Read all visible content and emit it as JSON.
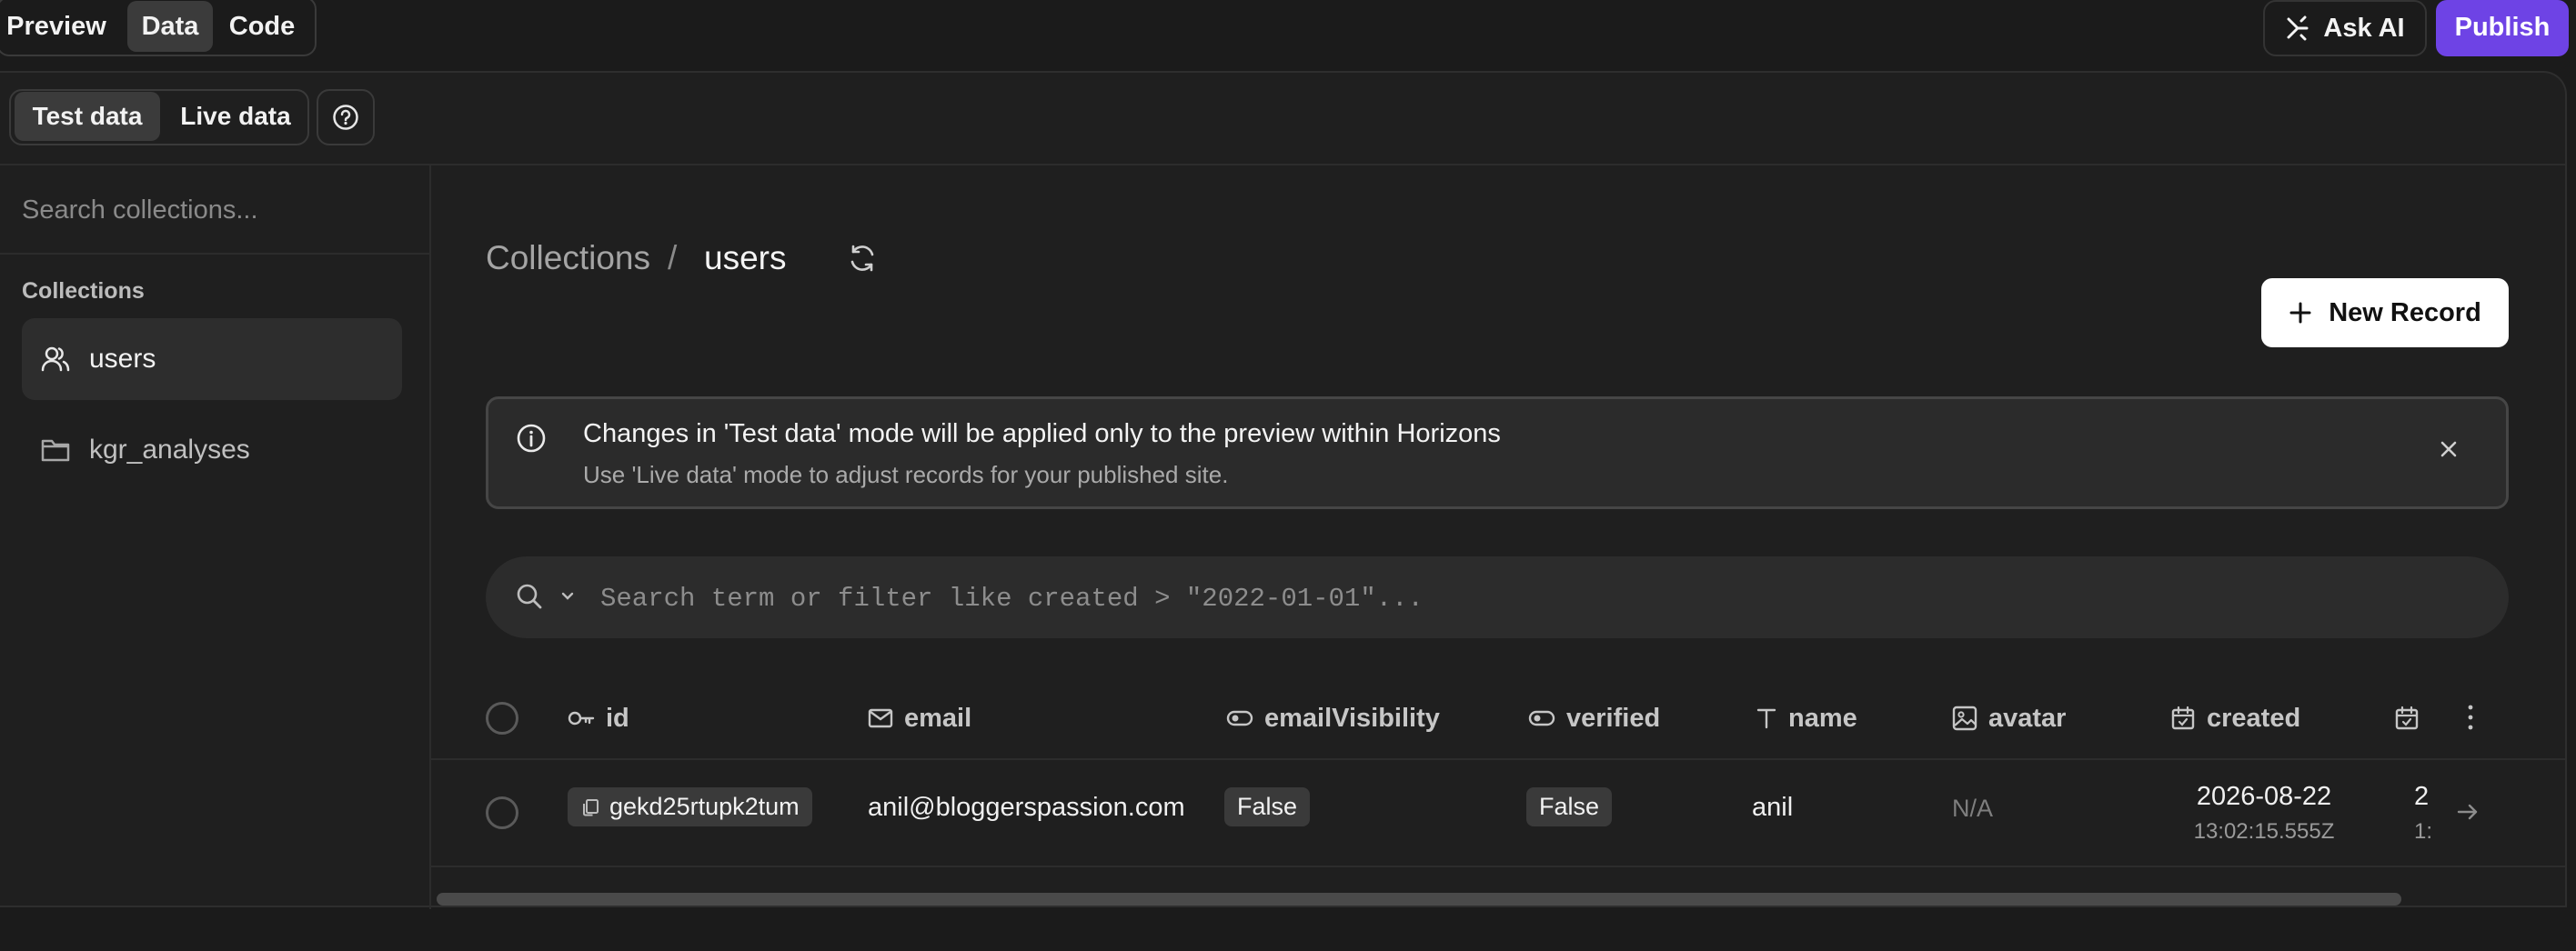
{
  "topbar": {
    "tabs": [
      {
        "label": "Preview",
        "active": false
      },
      {
        "label": "Data",
        "active": true
      },
      {
        "label": "Code",
        "active": false
      }
    ],
    "ask_ai": "Ask AI",
    "publish": "Publish",
    "publish_color": "#6e43e5"
  },
  "mode": {
    "tabs": [
      {
        "label": "Test data",
        "active": true
      },
      {
        "label": "Live data",
        "active": false
      }
    ],
    "help_icon": "question-circle-icon"
  },
  "sidebar": {
    "search_placeholder": "Search collections...",
    "section_title": "Collections",
    "items": [
      {
        "label": "users",
        "icon": "users-icon",
        "active": true
      },
      {
        "label": "kgr_analyses",
        "icon": "folder-icon",
        "active": false
      }
    ]
  },
  "main": {
    "breadcrumb": {
      "root": "Collections",
      "separator": "/",
      "current": "users"
    },
    "new_record": "New Record",
    "banner": {
      "title": "Changes in 'Test data' mode will be applied only to the preview within Horizons",
      "subtitle": "Use 'Live data' mode to adjust records for your published site."
    },
    "search_placeholder": "Search term or filter like created > \"2022-01-01\"...",
    "table": {
      "columns": [
        {
          "label": "id",
          "icon": "key-icon"
        },
        {
          "label": "email",
          "icon": "mail-icon"
        },
        {
          "label": "emailVisibility",
          "icon": "toggle-icon"
        },
        {
          "label": "verified",
          "icon": "toggle-icon"
        },
        {
          "label": "name",
          "icon": "text-icon"
        },
        {
          "label": "avatar",
          "icon": "image-icon"
        },
        {
          "label": "created",
          "icon": "calendar-icon"
        }
      ],
      "rows": [
        {
          "id": "gekd25rtupk2tum",
          "email": "anil@bloggerspassion.com",
          "emailVisibility": "False",
          "verified": "False",
          "name": "anil",
          "avatar": "N/A",
          "created_date": "2026-08-22",
          "created_time": "13:02:15.555Z",
          "updated_date_partial": "2",
          "updated_time_partial": "1:"
        }
      ]
    }
  }
}
